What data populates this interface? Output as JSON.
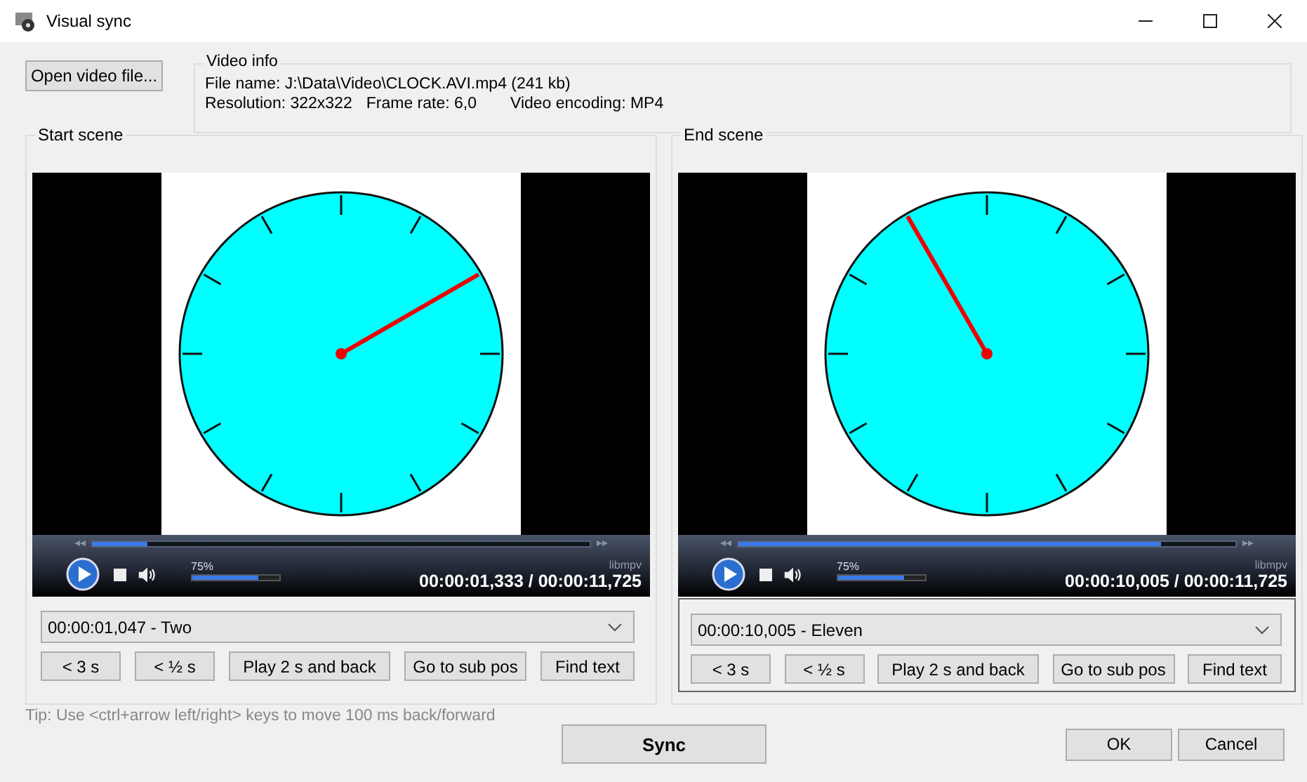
{
  "window": {
    "title": "Visual sync"
  },
  "open_button": "Open video file...",
  "video_info": {
    "title": "Video info",
    "file_name": "File name: J:\\Data\\Video\\CLOCK.AVI.mp4 (241 kb)",
    "resolution": "Resolution: 322x322",
    "frame_rate": "Frame rate: 6,0",
    "encoding": "Video encoding: MP4"
  },
  "scenes": [
    {
      "title": "Start scene",
      "focused": false,
      "player": {
        "level": 0.11,
        "volume": {
          "level": 0.75,
          "text": "75%"
        },
        "brand": "libmpv",
        "time": "00:00:01,333 / 00:00:11,725"
      },
      "subtitle": "00:00:01,047 - Two",
      "buttons": [
        "< 3 s",
        "< ½ s",
        "Play 2 s and back",
        "Go to sub pos",
        "Find text"
      ]
    },
    {
      "title": "End scene",
      "focused": true,
      "player": {
        "level": 0.85,
        "volume": {
          "level": 0.75,
          "text": "75%"
        },
        "brand": "libmpv",
        "time": "00:00:10,005 / 00:00:11,725"
      },
      "subtitle": "00:00:10,005 - Eleven",
      "buttons": [
        "< 3 s",
        "< ½ s",
        "Play 2 s and back",
        "Go to sub pos",
        "Find text"
      ]
    }
  ],
  "tip": "Tip: Use <ctrl+arrow left/right> keys to move 100 ms back/forward",
  "sync_button": "Sync",
  "dialog_buttons": [
    "OK",
    "Cancel"
  ]
}
